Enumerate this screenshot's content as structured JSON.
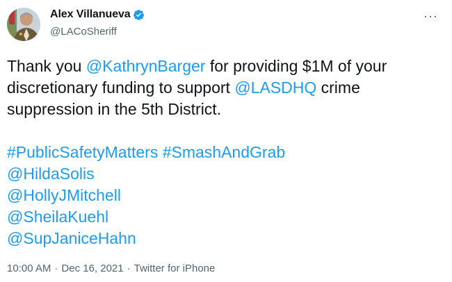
{
  "author": {
    "display_name": "Alex Villanueva",
    "handle": "@LACoSheriff"
  },
  "menu": {
    "more_label": "···"
  },
  "tweet": {
    "line1_text_a": "Thank you ",
    "line1_mention": "@KathrynBarger",
    "line1_text_b": " for providing $1M of your",
    "line2_text": "discretionary funding to support ",
    "line2_mention": "@LASDHQ",
    "line2_text_b": " crime",
    "line3_text": "suppression in the 5th District.",
    "hashtags": [
      "#PublicSafetyMatters",
      "#SmashAndGrab"
    ],
    "mentions": [
      "@HildaSolis",
      "@HollyJMitchell",
      "@SheilaKuehl",
      "@SupJaniceHahn"
    ]
  },
  "meta": {
    "time": "10:00 AM",
    "date": "Dec 16, 2021",
    "source": "Twitter for iPhone",
    "separator": "·"
  },
  "colors": {
    "link": "#1d9bf0",
    "text": "#0f1419",
    "muted": "#536471"
  }
}
